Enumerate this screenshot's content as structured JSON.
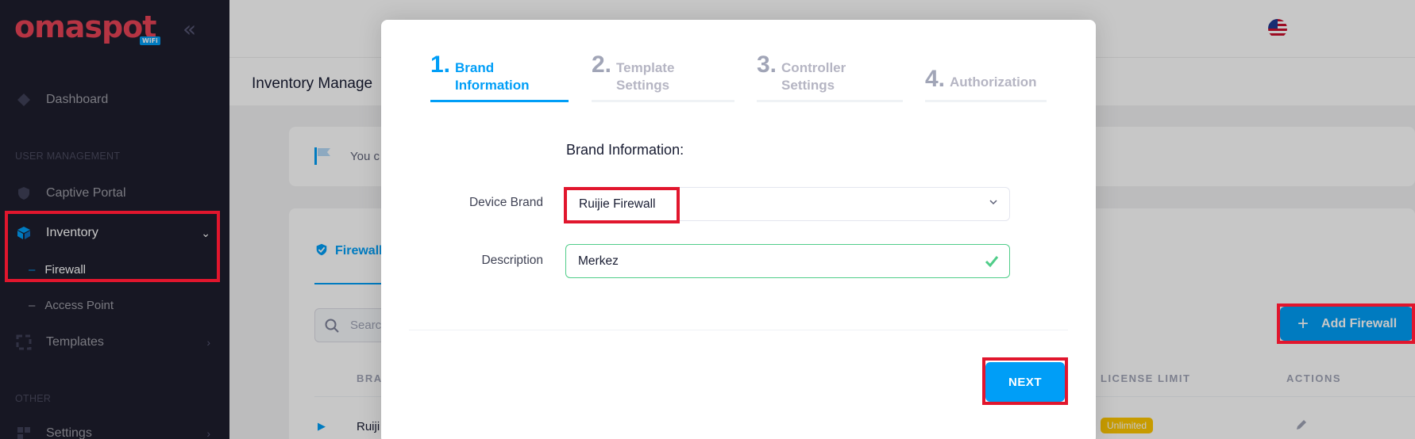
{
  "brand": {
    "name": "omaspot",
    "tag": "WiFi"
  },
  "sidebar": {
    "dashboard": "Dashboard",
    "section_user": "USER MANAGEMENT",
    "captive_portal": "Captive Portal",
    "inventory": "Inventory",
    "firewall": "Firewall",
    "access_point": "Access Point",
    "templates": "Templates",
    "section_other": "OTHER",
    "settings": "Settings"
  },
  "page": {
    "title": "Inventory Manage",
    "notice": "You c",
    "tab_firewall": "Firewall",
    "search_placeholder": "Searc",
    "add_button": "Add Firewall",
    "columns": {
      "brand": "BRA",
      "license_limit": "LICENSE LIMIT",
      "actions": "ACTIONS"
    },
    "row": {
      "name": "Ruiji",
      "license": "Unlimited"
    }
  },
  "wizard": {
    "steps": [
      {
        "num": "1.",
        "label": "Brand\nInformation",
        "state": "active"
      },
      {
        "num": "2.",
        "label": "Template\nSettings",
        "state": "inactive"
      },
      {
        "num": "3.",
        "label": "Controller\nSettings",
        "state": "inactive"
      },
      {
        "num": "4.",
        "label": "Authorization",
        "state": "inactive"
      }
    ],
    "form_title": "Brand Information:",
    "device_brand_label": "Device Brand",
    "device_brand_value": "Ruijie Firewall",
    "description_label": "Description",
    "description_value": "Merkez",
    "next_button": "NEXT"
  },
  "colors": {
    "primary": "#009ef7",
    "sidebar": "#1e1e2d",
    "highlight": "#e1162d",
    "success": "#50cd89",
    "warning": "#ffc700"
  }
}
